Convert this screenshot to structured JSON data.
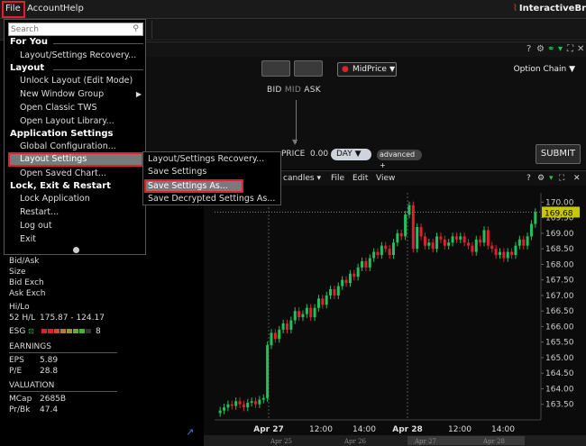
{
  "menubar": {
    "file": "File",
    "account": "Account",
    "help": "Help",
    "brand": "InteractiveBr"
  },
  "file_menu": {
    "search_placeholder": "Search",
    "sections": {
      "for_you": "For You",
      "layout": "Layout",
      "application_settings": "Application Settings",
      "lock_exit_restart": "Lock, Exit & Restart"
    },
    "items": {
      "layout_settings_recovery": "Layout/Settings Recovery...",
      "unlock_layout": "Unlock Layout (Edit Mode)",
      "new_window_group": "New Window Group",
      "open_classic_tws": "Open Classic TWS",
      "open_layout_library": "Open Layout Library...",
      "global_configuration": "Global Configuration...",
      "layout_settings": "Layout Settings",
      "open_saved_chart": "Open Saved Chart...",
      "lock_application": "Lock Application",
      "restart": "Restart...",
      "log_out": "Log out",
      "exit": "Exit"
    }
  },
  "sub_menu": {
    "items": [
      "Layout/Settings Recovery...",
      "Save Settings",
      "Save Settings As...",
      "Save Decrypted Settings As..."
    ]
  },
  "order_panel": {
    "bid": "BID",
    "mid": "MID",
    "ask": "ASK",
    "order_type": "MidPrice",
    "option_chain": "Option Chain",
    "price_label": "PRICE",
    "price_value": "0.00",
    "tif": "DAY",
    "advanced": "advanced",
    "submit": "SUBMIT"
  },
  "chart_panel": {
    "bar_type": "candles",
    "menu_file": "File",
    "menu_edit": "Edit",
    "menu_view": "View",
    "last_price": "169.68"
  },
  "chart_data": {
    "type": "candlestick",
    "ylim": [
      163.0,
      170.3
    ],
    "y_ticks": [
      "170.00",
      "169.50",
      "169.00",
      "168.50",
      "168.00",
      "167.50",
      "167.00",
      "166.50",
      "166.00",
      "165.50",
      "165.00",
      "164.50",
      "164.00",
      "163.50"
    ],
    "x_ticks": [
      "Apr 27",
      "12:00",
      "14:00",
      "Apr 28",
      "12:00",
      "14:00"
    ],
    "navigator_ticks": [
      "Apr 25",
      "Apr 26",
      "Apr 27",
      "Apr 28"
    ],
    "last_price": 169.68,
    "series_close": [
      163.3,
      163.4,
      163.5,
      163.45,
      163.6,
      163.5,
      163.4,
      163.55,
      163.6,
      163.5,
      163.65,
      163.7,
      165.4,
      165.8,
      165.6,
      165.9,
      166.1,
      165.9,
      166.2,
      166.5,
      166.3,
      166.4,
      166.6,
      166.3,
      166.6,
      166.9,
      166.7,
      167.0,
      167.2,
      167.0,
      167.3,
      167.5,
      167.4,
      167.7,
      167.6,
      167.9,
      168.1,
      167.9,
      168.2,
      168.4,
      168.3,
      168.6,
      168.5,
      168.3,
      168.7,
      169.0,
      168.9,
      169.6,
      169.9,
      168.5,
      169.2,
      168.9,
      168.6,
      168.7,
      168.5,
      168.9,
      168.8,
      168.6,
      168.7,
      168.9,
      168.8,
      168.9,
      168.7,
      168.6,
      168.4,
      168.8,
      168.7,
      169.1,
      168.6,
      168.5,
      168.3,
      168.4,
      168.2,
      168.4,
      168.3,
      168.6,
      168.8,
      168.6,
      168.9,
      169.3,
      169.68
    ]
  },
  "left_info": {
    "bid_ask": "Bid/Ask",
    "size": "Size",
    "bid_exch": "Bid Exch",
    "ask_exch": "Ask Exch",
    "hi_lo": "Hi/Lo",
    "hl52_label": "52 H/L",
    "hl52_value": "175.87 - 124.17",
    "esg_label": "ESG",
    "esg_value": "8",
    "earnings": "EARNINGS",
    "eps_label": "EPS",
    "eps_value": "5.89",
    "pe_label": "P/E",
    "pe_value": "28.8",
    "valuation": "VALUATION",
    "mcap_label": "MCap",
    "mcap_value": "2685B",
    "prbk_label": "Pr/Bk",
    "prbk_value": "47.4"
  },
  "colors": {
    "up": "#22c25a",
    "down": "#e0202c",
    "highlight_border": "#e0202c",
    "last_price_tag": "#c8c800"
  }
}
